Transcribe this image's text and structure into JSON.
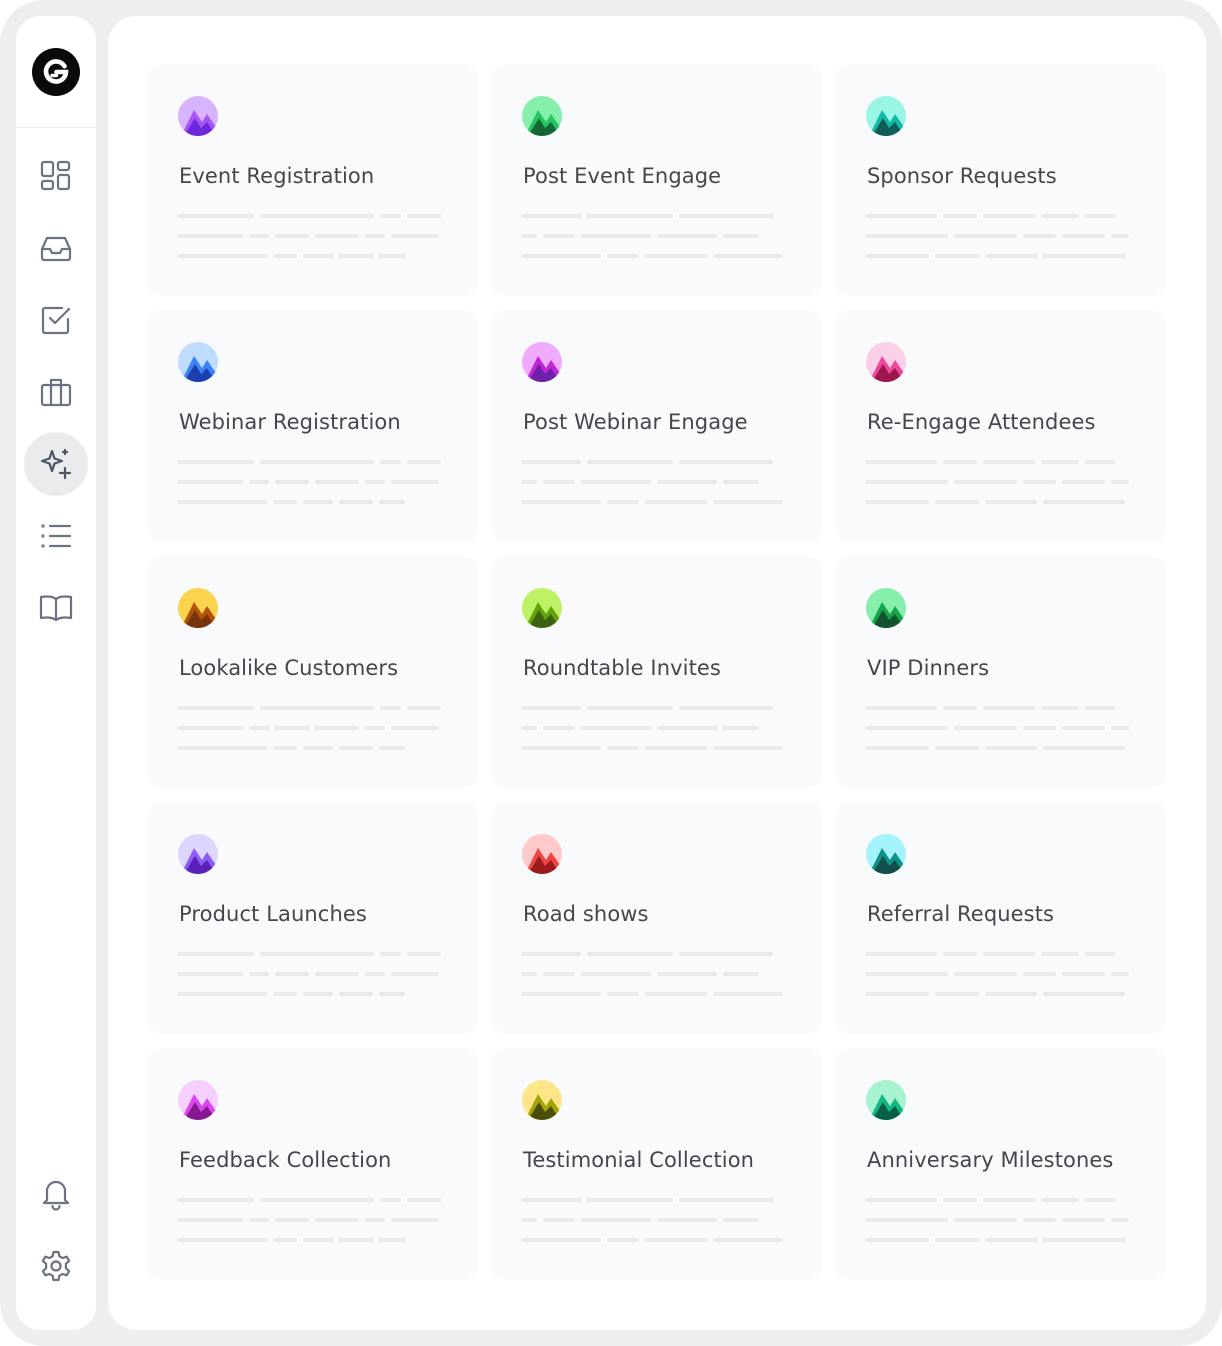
{
  "colors": {
    "frame": "#eeeeef",
    "surface": "#ffffff",
    "card": "#f9fafb",
    "placeholder_line": "#e9eaee",
    "title_text": "#43464d",
    "icon_stroke": "#6b7280",
    "active_nav": "#ebebee"
  },
  "sidebar": {
    "logo_icon": "g-logo-icon",
    "items": [
      {
        "name": "dashboard",
        "icon": "dashboard-grid-icon",
        "active": false
      },
      {
        "name": "inbox",
        "icon": "inbox-tray-icon",
        "active": false
      },
      {
        "name": "tasks",
        "icon": "checkbox-icon",
        "active": false
      },
      {
        "name": "briefcase",
        "icon": "briefcase-icon",
        "active": false
      },
      {
        "name": "ai-sparkles",
        "icon": "sparkles-icon",
        "active": true
      },
      {
        "name": "list",
        "icon": "list-icon",
        "active": false
      },
      {
        "name": "library",
        "icon": "open-book-icon",
        "active": false
      }
    ],
    "bottom_items": [
      {
        "name": "notifications",
        "icon": "bell-icon"
      },
      {
        "name": "settings",
        "icon": "gear-icon"
      }
    ]
  },
  "cards": [
    {
      "title": "Event Registration",
      "icon": "mountain-avatar-icon",
      "colors": [
        "#d8b4fe",
        "#a855f7",
        "#6d28d9"
      ]
    },
    {
      "title": "Post Event Engage",
      "icon": "mountain-avatar-icon",
      "colors": [
        "#86efac",
        "#22c55e",
        "#166534"
      ]
    },
    {
      "title": "Sponsor Requests",
      "icon": "mountain-avatar-icon",
      "colors": [
        "#99f6e4",
        "#14b8a6",
        "#115e59"
      ]
    },
    {
      "title": "Webinar Registration",
      "icon": "mountain-avatar-icon",
      "colors": [
        "#bfdbfe",
        "#3b82f6",
        "#1e40af"
      ]
    },
    {
      "title": "Post Webinar Engage",
      "icon": "mountain-avatar-icon",
      "colors": [
        "#f0abfc",
        "#c026d3",
        "#6b21a8"
      ]
    },
    {
      "title": "Re-Engage Attendees",
      "icon": "mountain-avatar-icon",
      "colors": [
        "#fbcfe8",
        "#ec4899",
        "#9d174d"
      ]
    },
    {
      "title": "Lookalike Customers",
      "icon": "mountain-avatar-icon",
      "colors": [
        "#fcd34d",
        "#b45309",
        "#78350f"
      ]
    },
    {
      "title": "Roundtable Invites",
      "icon": "mountain-avatar-icon",
      "colors": [
        "#bef264",
        "#65a30d",
        "#3f6212"
      ]
    },
    {
      "title": "VIP Dinners",
      "icon": "mountain-avatar-icon",
      "colors": [
        "#86efac",
        "#16a34a",
        "#14532d"
      ]
    },
    {
      "title": "Product Launches",
      "icon": "mountain-avatar-icon",
      "colors": [
        "#ddd6fe",
        "#8b5cf6",
        "#5b21b6"
      ]
    },
    {
      "title": "Road shows",
      "icon": "mountain-avatar-icon",
      "colors": [
        "#fecaca",
        "#ef4444",
        "#991b1b"
      ]
    },
    {
      "title": "Referral Requests",
      "icon": "mountain-avatar-icon",
      "colors": [
        "#a5f3fc",
        "#0d9488",
        "#134e4a"
      ]
    },
    {
      "title": "Feedback Collection",
      "icon": "mountain-avatar-icon",
      "colors": [
        "#f5d0fe",
        "#d946ef",
        "#86198f"
      ]
    },
    {
      "title": "Testimonial Collection",
      "icon": "mountain-avatar-icon",
      "colors": [
        "#fde68a",
        "#a3a30a",
        "#4d4d0a"
      ]
    },
    {
      "title": "Anniversary Milestones",
      "icon": "mountain-avatar-icon",
      "colors": [
        "#a7f3d0",
        "#10b981",
        "#065f46"
      ]
    }
  ]
}
